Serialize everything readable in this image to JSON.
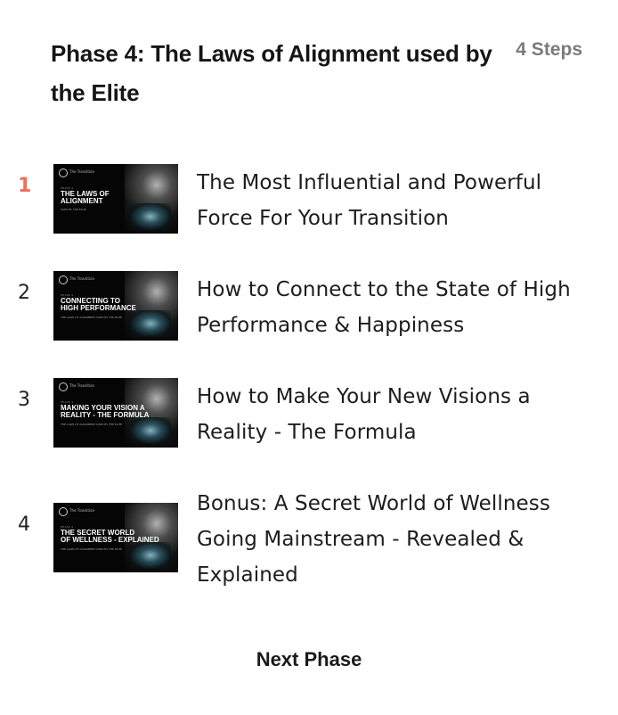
{
  "phase": {
    "title": "Phase 4: The Laws of Alignment used by the Elite",
    "step_count": "4 Steps"
  },
  "steps": [
    {
      "number": "1",
      "active": true,
      "title": "The Most Influential and Powerful Force For Your Transition",
      "thumbnail": {
        "brand": "The Transition",
        "heading": "THE LAWS OF\nALIGNMENT",
        "phase_label": "PHASE 4",
        "sub": "USED BY THE ELITE"
      }
    },
    {
      "number": "2",
      "active": false,
      "title": "How to Connect to the State of High Performance & Happiness",
      "thumbnail": {
        "brand": "The Transition",
        "heading": "CONNECTING TO\nHIGH PERFORMANCE",
        "phase_label": "PHASE 4",
        "sub": "THE LAWS OF ALIGNMENT USED BY THE ELITE"
      }
    },
    {
      "number": "3",
      "active": false,
      "title": "How to Make Your New Visions a Reality - The Formula",
      "thumbnail": {
        "brand": "The Transition",
        "heading": "MAKING YOUR VISION A\nREALITY - THE FORMULA",
        "phase_label": "PHASE 4",
        "sub": "THE LAWS OF ALIGNMENT USED BY THE ELITE"
      }
    },
    {
      "number": "4",
      "active": false,
      "title": "Bonus: A Secret World of Wellness Going Mainstream - Revealed & Explained",
      "thumbnail": {
        "brand": "The Transition",
        "heading": "THE SECRET WORLD\nOF WELLNESS - EXPLAINED",
        "phase_label": "PHASE 4",
        "sub": "THE LAWS OF ALIGNMENT USED BY THE ELITE"
      }
    }
  ],
  "footer": {
    "next_label": "Next Phase"
  },
  "colors": {
    "active_step": "#ef6f5f",
    "step_count": "#7b7b7b",
    "text": "#1d1d1d",
    "thumbnail_bg": "#050505"
  },
  "icons": {
    "thumbnail_logo": "circle-logo-icon"
  }
}
